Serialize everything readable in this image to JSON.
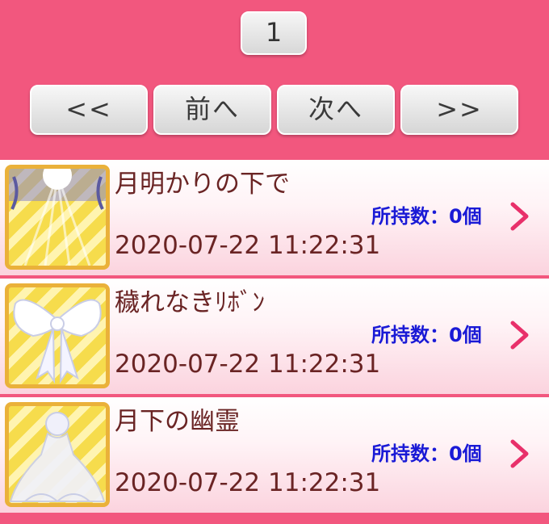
{
  "pagination": {
    "current_page": "1",
    "first_label": "<<",
    "prev_label": "前へ",
    "next_label": "次へ",
    "last_label": ">>"
  },
  "items": [
    {
      "name": "月明かりの下で",
      "count": "所持数：0個",
      "date": "2020-07-22 11:22:31",
      "icon": "moonlight-dress-icon"
    },
    {
      "name": "穢れなきﾘﾎﾞﾝ",
      "count": "所持数：0個",
      "date": "2020-07-22 11:22:31",
      "icon": "white-ribbon-icon"
    },
    {
      "name": "月下の幽霊",
      "count": "所持数：0個",
      "date": "2020-07-22 11:22:31",
      "icon": "ghost-dress-icon"
    }
  ],
  "colors": {
    "background": "#f2577e",
    "item_text": "#6a2424",
    "count_text": "#1a1ad6",
    "chevron": "#e8306a",
    "thumb_border": "#eab13a"
  }
}
